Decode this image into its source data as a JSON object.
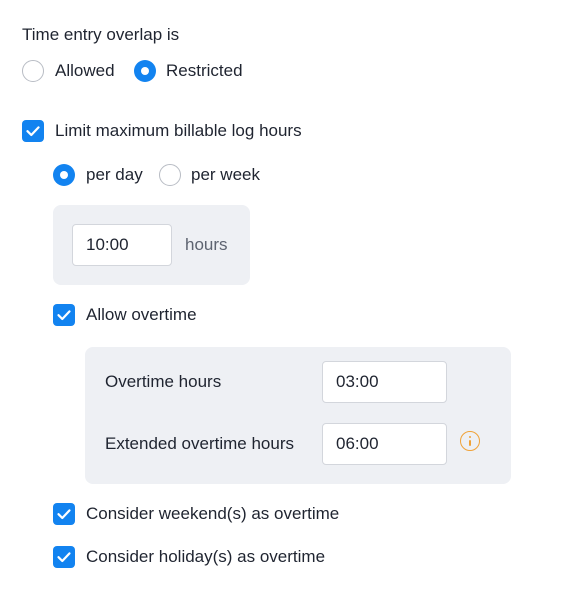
{
  "overlap": {
    "heading": "Time entry overlap is",
    "options": [
      {
        "label": "Allowed",
        "selected": false
      },
      {
        "label": "Restricted",
        "selected": true
      }
    ]
  },
  "limit": {
    "label": "Limit maximum billable log hours",
    "checked": true,
    "period_options": [
      {
        "label": "per day",
        "selected": true
      },
      {
        "label": "per week",
        "selected": false
      }
    ],
    "hours_value": "10:00",
    "hours_unit": "hours"
  },
  "overtime": {
    "label": "Allow overtime",
    "checked": true,
    "overtime_hours_label": "Overtime hours",
    "overtime_hours_value": "03:00",
    "extended_label": "Extended overtime hours",
    "extended_value": "06:00",
    "info_icon": "info-icon"
  },
  "weekend": {
    "label": "Consider weekend(s) as overtime",
    "checked": true
  },
  "holiday": {
    "label": "Consider holiday(s) as overtime",
    "checked": true
  },
  "colors": {
    "accent": "#1283f0",
    "panel": "#eef0f4",
    "info": "#f0a238"
  }
}
